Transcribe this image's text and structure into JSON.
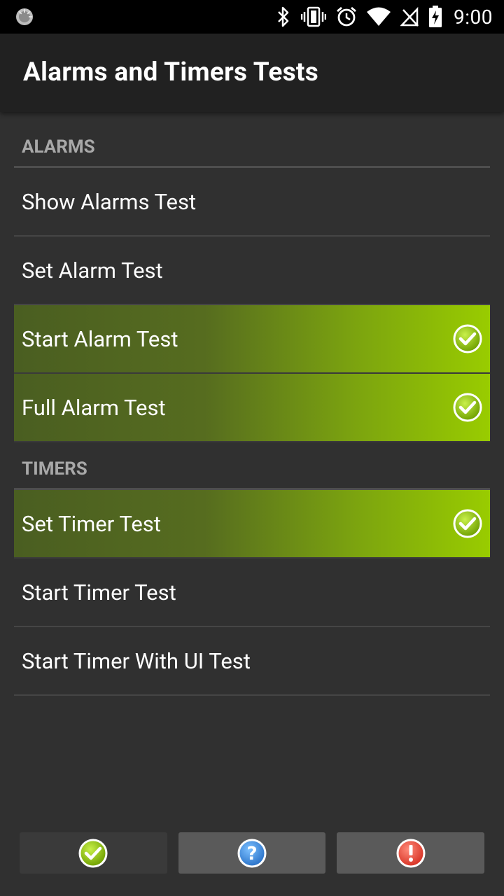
{
  "status_bar": {
    "time": "9:00",
    "icons": [
      "loading-icon",
      "bluetooth-icon",
      "vibrate-icon",
      "alarm-icon",
      "wifi-icon",
      "no-signal-icon",
      "battery-charging-icon"
    ]
  },
  "app_bar": {
    "title": "Alarms and Timers Tests"
  },
  "sections": {
    "alarms": {
      "header": "ALARMS",
      "items": [
        {
          "label": "Show Alarms Test",
          "passed": false
        },
        {
          "label": "Set Alarm Test",
          "passed": false
        },
        {
          "label": "Start Alarm Test",
          "passed": true
        },
        {
          "label": "Full Alarm Test",
          "passed": true
        }
      ]
    },
    "timers": {
      "header": "TIMERS",
      "items": [
        {
          "label": "Set Timer Test",
          "passed": true
        },
        {
          "label": "Start Timer Test",
          "passed": false
        },
        {
          "label": "Start Timer With UI Test",
          "passed": false
        }
      ]
    }
  },
  "bottom_bar": {
    "buttons": [
      {
        "icon": "pass-check-icon",
        "color": "#99cc00"
      },
      {
        "icon": "info-question-icon",
        "color": "#3b8fe0"
      },
      {
        "icon": "fail-exclamation-icon",
        "color": "#e8453c"
      }
    ]
  },
  "colors": {
    "background": "#303030",
    "app_bar": "#212121",
    "pass_green": "#99cc00",
    "header_text": "#a8a8a8"
  }
}
